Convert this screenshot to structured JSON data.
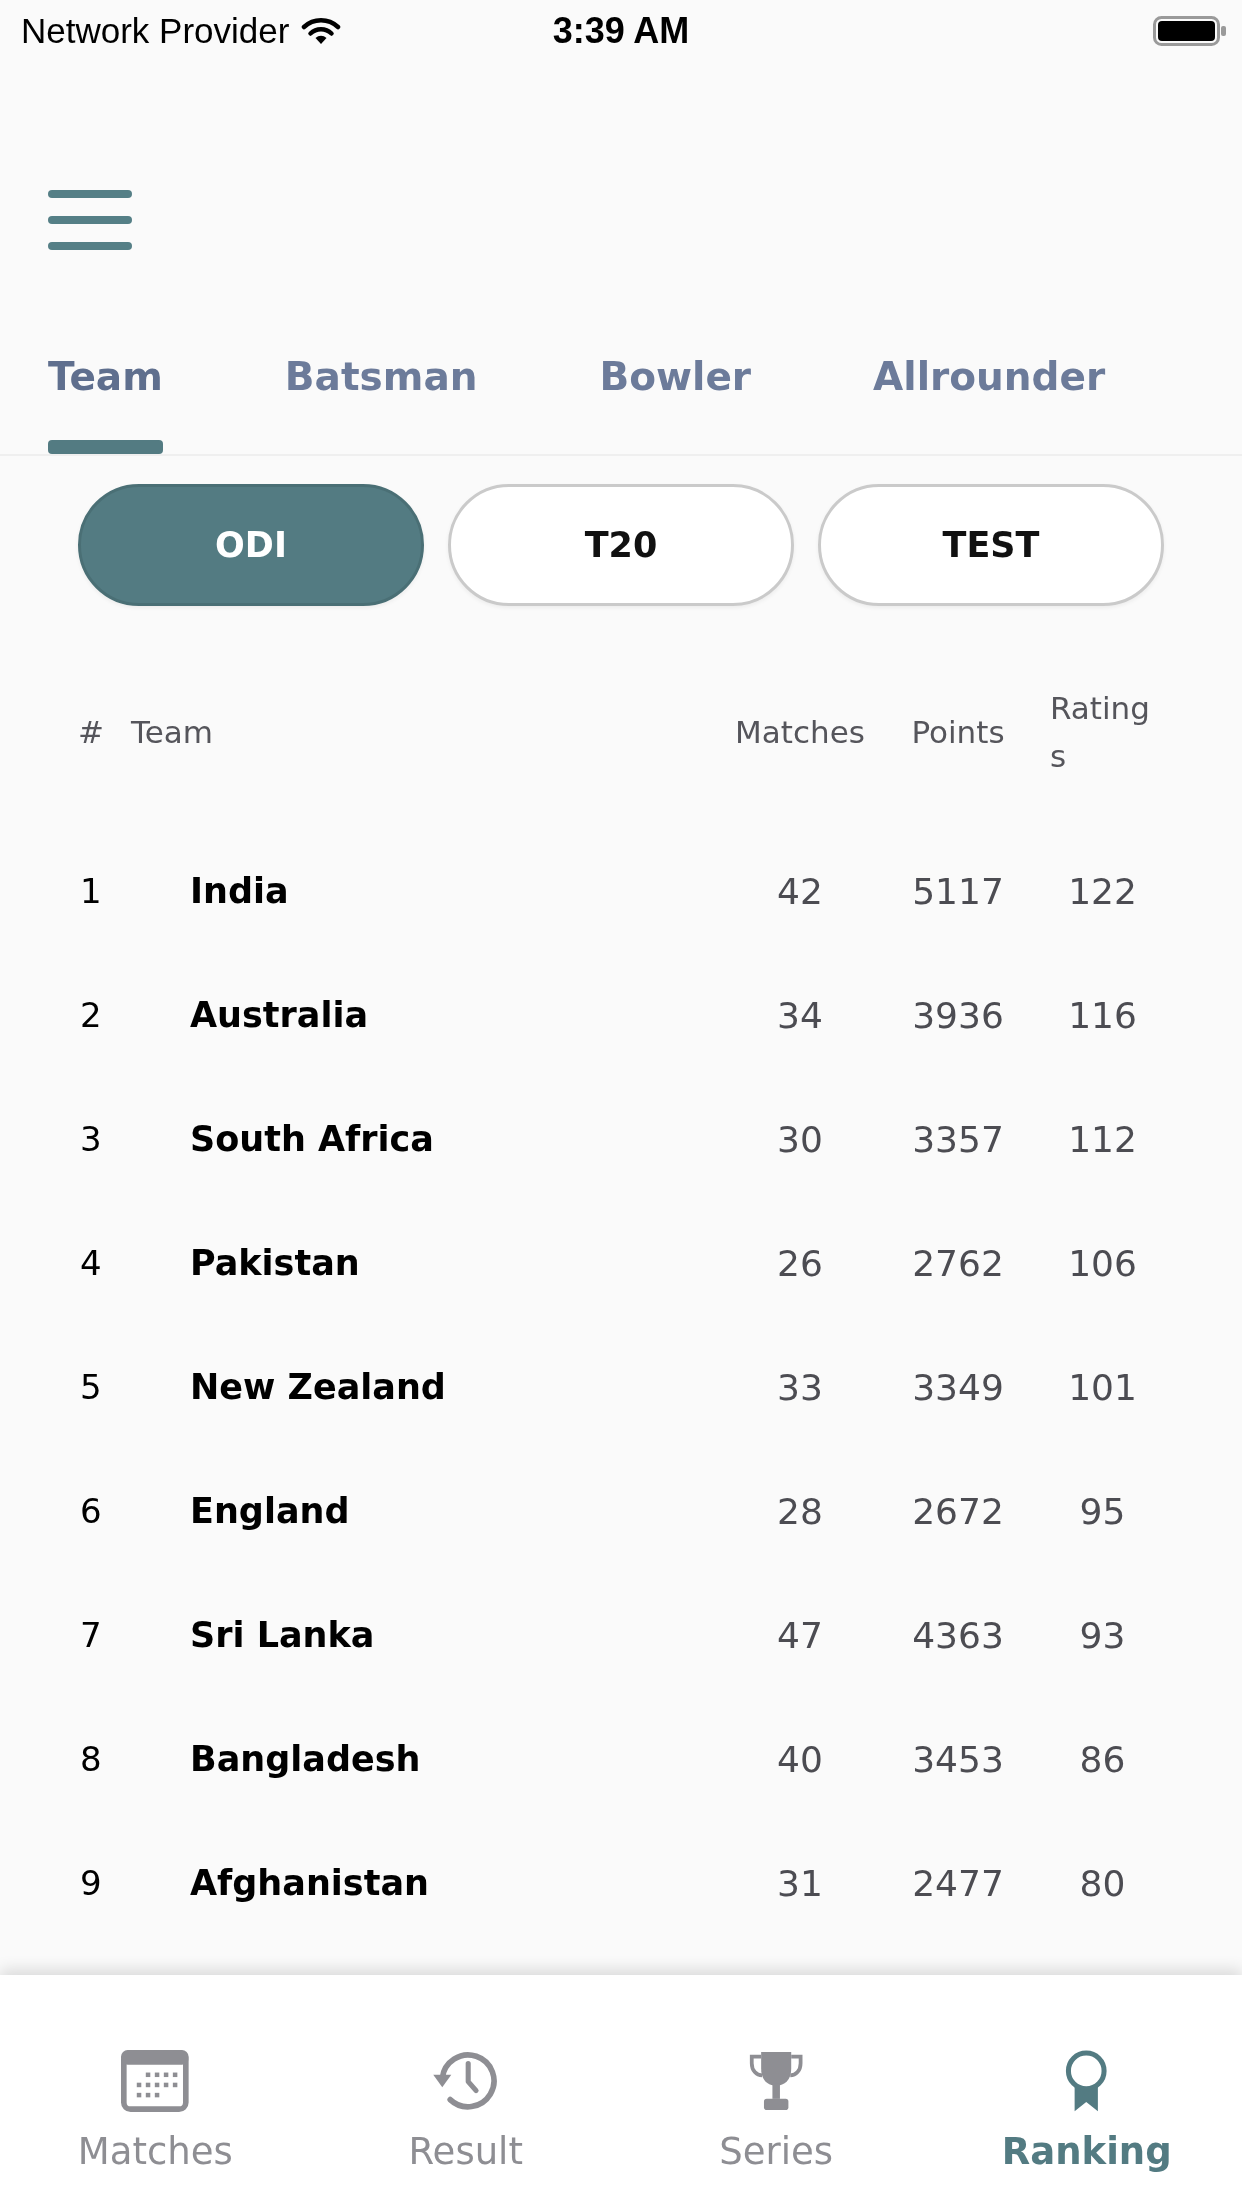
{
  "status_bar": {
    "carrier": "Network Provider",
    "time": "3:39 AM"
  },
  "tabs": [
    {
      "label": "Team",
      "selected": true
    },
    {
      "label": "Batsman",
      "selected": false
    },
    {
      "label": "Bowler",
      "selected": false
    },
    {
      "label": "Allrounder",
      "selected": false
    }
  ],
  "formats": [
    {
      "label": "ODI",
      "selected": true
    },
    {
      "label": "T20",
      "selected": false
    },
    {
      "label": "TEST",
      "selected": false
    }
  ],
  "table": {
    "columns": [
      "#",
      "Team",
      "Matches",
      "Points",
      "Ratings"
    ],
    "rows": [
      {
        "rank": "1",
        "team": "India",
        "matches": "42",
        "points": "5117",
        "rating": "122"
      },
      {
        "rank": "2",
        "team": "Australia",
        "matches": "34",
        "points": "3936",
        "rating": "116"
      },
      {
        "rank": "3",
        "team": "South Africa",
        "matches": "30",
        "points": "3357",
        "rating": "112"
      },
      {
        "rank": "4",
        "team": "Pakistan",
        "matches": "26",
        "points": "2762",
        "rating": "106"
      },
      {
        "rank": "5",
        "team": "New Zealand",
        "matches": "33",
        "points": "3349",
        "rating": "101"
      },
      {
        "rank": "6",
        "team": "England",
        "matches": "28",
        "points": "2672",
        "rating": "95"
      },
      {
        "rank": "7",
        "team": "Sri Lanka",
        "matches": "47",
        "points": "4363",
        "rating": "93"
      },
      {
        "rank": "8",
        "team": "Bangladesh",
        "matches": "40",
        "points": "3453",
        "rating": "86"
      },
      {
        "rank": "9",
        "team": "Afghanistan",
        "matches": "31",
        "points": "2477",
        "rating": "80"
      }
    ]
  },
  "bottom_nav": [
    {
      "label": "Matches",
      "selected": false
    },
    {
      "label": "Result",
      "selected": false
    },
    {
      "label": "Series",
      "selected": false
    },
    {
      "label": "Ranking",
      "selected": true
    }
  ]
}
